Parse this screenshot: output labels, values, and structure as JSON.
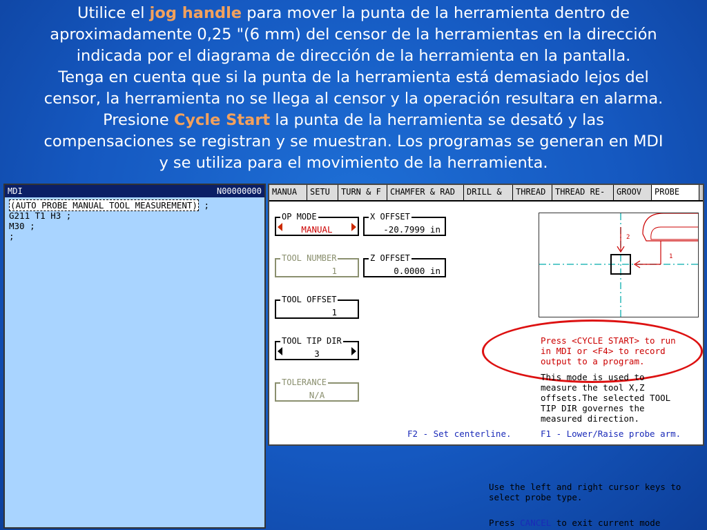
{
  "caption": {
    "l1a": "Utilice el ",
    "l1b": "jog handle",
    "l1c": " para mover la punta de la herramienta dentro de",
    "l2": "aproximadamente 0,25 \"(6 mm) del censor de la herramientas en la dirección",
    "l3": "indicada por el diagrama de dirección de la herramienta en la pantalla.",
    "l4": "Tenga en cuenta que si la punta de la herramienta está demasiado lejos del",
    "l5": "censor, la herramienta no se llega al censor y la operación resultara en alarma.",
    "l6a": "Presione ",
    "l6b": "Cycle Start",
    "l6c": " la punta de la herramienta se desató y las",
    "l7": "compensaciones se registran y se muestran.  Los programas se generan en MDI",
    "l8": "y se utiliza para el movimiento de la herramienta."
  },
  "mdi": {
    "title": "MDI",
    "program": "N00000000",
    "lines": [
      "(AUTO PROBE MANUAL TOOL MEASUREMENT)",
      " ;",
      "G211 T1 H3 ;",
      "M30 ;",
      ";"
    ]
  },
  "tabs": [
    "MANUA",
    "SETU",
    "TURN & F",
    "CHAMFER & RAD",
    "DRILL &",
    "THREAD",
    "THREAD RE-",
    "GROOV",
    "PROBE"
  ],
  "fields": {
    "op_mode": {
      "label": "OP MODE",
      "value": "MANUAL"
    },
    "x_offset": {
      "label": "X OFFSET",
      "value": "-20.7999 in"
    },
    "tool_number": {
      "label": "TOOL NUMBER",
      "value": "1"
    },
    "z_offset": {
      "label": "Z OFFSET",
      "value": "0.0000 in"
    },
    "tool_offset": {
      "label": "TOOL OFFSET",
      "value": "1"
    },
    "tool_tip_dir": {
      "label": "TOOL TIP DIR",
      "value": "3"
    },
    "tolerance": {
      "label": "TOLERANCE",
      "value": "N/A"
    }
  },
  "diagram": {
    "label_2": "2",
    "label_1": "1"
  },
  "messages": {
    "press1": "Press <CYCLE START> to run",
    "press2": "in MDI or <F4> to record",
    "press3": "output to a program.",
    "mode1": "This mode is used to",
    "mode2": "measure the tool X,Z",
    "mode3": "offsets.The selected TOOL",
    "mode4": "TIP DIR governes the",
    "mode5": "measured direction.",
    "f2": "F2 - Set centerline.",
    "f1": "F1 - Lower/Raise probe arm."
  },
  "bottom": {
    "use1": "Use the left and right cursor keys to",
    "use2": "select probe type.",
    "cancel_pre": "Press ",
    "cancel_key": "CANCEL",
    "cancel_post": " to exit current mode"
  },
  "colors": {
    "highlight": "#f2a15d",
    "screen_red": "#cc0000",
    "screen_blue": "#1a2ab8",
    "mdi_bg": "#a9d4ff"
  }
}
